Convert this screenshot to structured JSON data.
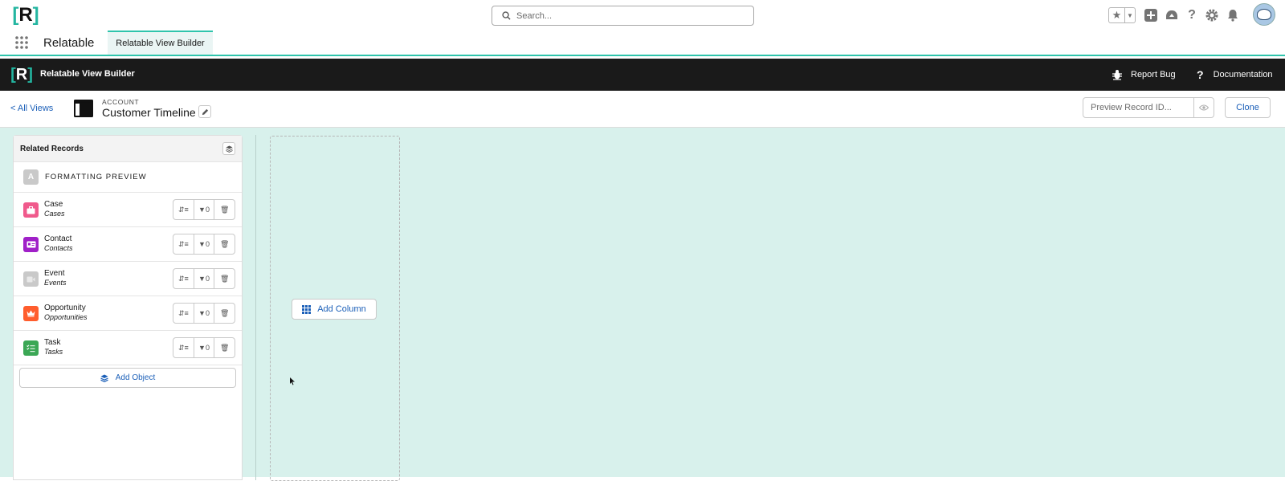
{
  "global_header": {
    "logo_text": "R",
    "search": {
      "placeholder": "Search..."
    },
    "icons": [
      "favorites-star-icon",
      "favorites-dropdown-icon",
      "global-add-icon",
      "trailhead-icon",
      "help-icon",
      "setup-gear-icon",
      "notifications-bell-icon",
      "avatar"
    ]
  },
  "app_nav": {
    "app_name": "Relatable",
    "tabs": [
      {
        "label": "Relatable View Builder",
        "active": true
      }
    ]
  },
  "black_bar": {
    "title": "Relatable View Builder",
    "report_bug": "Report Bug",
    "documentation": "Documentation"
  },
  "sub_header": {
    "back_link": "< All Views",
    "object_type": "ACCOUNT",
    "view_name": "Customer Timeline",
    "preview_placeholder": "Preview Record ID...",
    "clone_label": "Clone"
  },
  "related_panel": {
    "title": "Related Records",
    "formatting_preview": "FORMATTING PREVIEW",
    "objects": [
      {
        "label": "Case",
        "sub": "Cases",
        "color": "#f05a8c",
        "filter_count": "0"
      },
      {
        "label": "Contact",
        "sub": "Contacts",
        "color": "#a020c8",
        "filter_count": "0"
      },
      {
        "label": "Event",
        "sub": "Events",
        "color": "#c9c9c9",
        "filter_count": "0"
      },
      {
        "label": "Opportunity",
        "sub": "Opportunities",
        "color": "#ff5d2d",
        "filter_count": "0"
      },
      {
        "label": "Task",
        "sub": "Tasks",
        "color": "#3ba755",
        "filter_count": "0"
      }
    ],
    "add_object_label": "Add Object"
  },
  "canvas": {
    "add_column_label": "Add Column"
  },
  "colors": {
    "accent_teal": "#2fc4ac",
    "canvas_bg": "#d8f1ec",
    "link_blue": "#1b5fb8"
  }
}
